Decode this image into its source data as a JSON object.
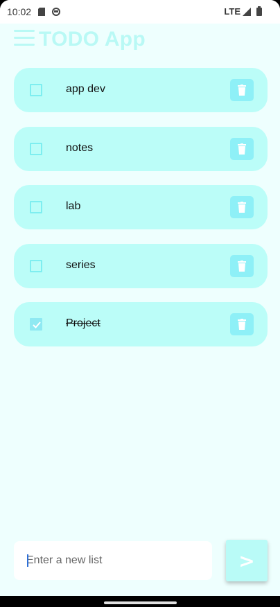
{
  "status_bar": {
    "time": "10:02",
    "network": "LTE",
    "icons": [
      "sd-card-icon",
      "sync-icon",
      "signal-icon",
      "battery-icon"
    ]
  },
  "header": {
    "title": "TODO App",
    "menu_icon": "menu-icon"
  },
  "todos": [
    {
      "label": "app dev",
      "checked": false
    },
    {
      "label": "notes",
      "checked": false
    },
    {
      "label": "lab",
      "checked": false
    },
    {
      "label": "series",
      "checked": false
    },
    {
      "label": "Project",
      "checked": true
    }
  ],
  "input": {
    "placeholder": "Enter a new list",
    "value": ""
  },
  "send_button": {
    "label": ">"
  },
  "colors": {
    "background": "#eefffe",
    "card": "#bbfdf8",
    "accent": "#8ef0f7",
    "title": "#b9f9f5"
  }
}
